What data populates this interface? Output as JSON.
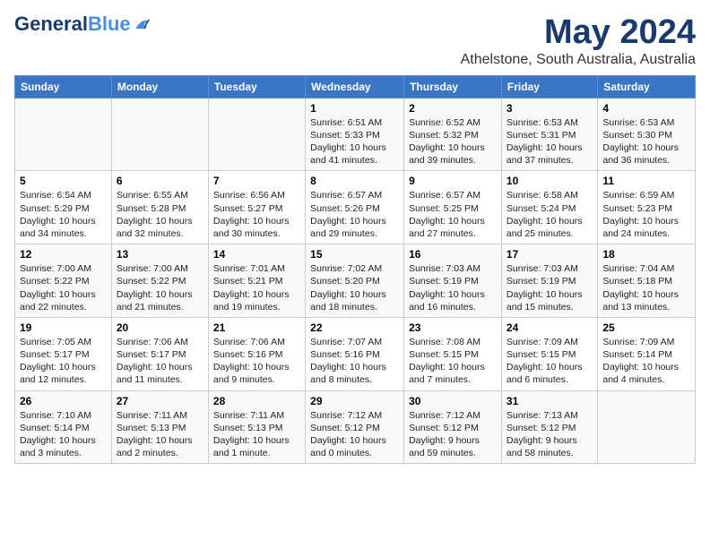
{
  "header": {
    "logo_line1": "General",
    "logo_line2": "Blue",
    "title": "May 2024",
    "subtitle": "Athelstone, South Australia, Australia"
  },
  "weekdays": [
    "Sunday",
    "Monday",
    "Tuesday",
    "Wednesday",
    "Thursday",
    "Friday",
    "Saturday"
  ],
  "weeks": [
    [
      {
        "day": "",
        "info": ""
      },
      {
        "day": "",
        "info": ""
      },
      {
        "day": "",
        "info": ""
      },
      {
        "day": "1",
        "info": "Sunrise: 6:51 AM\nSunset: 5:33 PM\nDaylight: 10 hours\nand 41 minutes."
      },
      {
        "day": "2",
        "info": "Sunrise: 6:52 AM\nSunset: 5:32 PM\nDaylight: 10 hours\nand 39 minutes."
      },
      {
        "day": "3",
        "info": "Sunrise: 6:53 AM\nSunset: 5:31 PM\nDaylight: 10 hours\nand 37 minutes."
      },
      {
        "day": "4",
        "info": "Sunrise: 6:53 AM\nSunset: 5:30 PM\nDaylight: 10 hours\nand 36 minutes."
      }
    ],
    [
      {
        "day": "5",
        "info": "Sunrise: 6:54 AM\nSunset: 5:29 PM\nDaylight: 10 hours\nand 34 minutes."
      },
      {
        "day": "6",
        "info": "Sunrise: 6:55 AM\nSunset: 5:28 PM\nDaylight: 10 hours\nand 32 minutes."
      },
      {
        "day": "7",
        "info": "Sunrise: 6:56 AM\nSunset: 5:27 PM\nDaylight: 10 hours\nand 30 minutes."
      },
      {
        "day": "8",
        "info": "Sunrise: 6:57 AM\nSunset: 5:26 PM\nDaylight: 10 hours\nand 29 minutes."
      },
      {
        "day": "9",
        "info": "Sunrise: 6:57 AM\nSunset: 5:25 PM\nDaylight: 10 hours\nand 27 minutes."
      },
      {
        "day": "10",
        "info": "Sunrise: 6:58 AM\nSunset: 5:24 PM\nDaylight: 10 hours\nand 25 minutes."
      },
      {
        "day": "11",
        "info": "Sunrise: 6:59 AM\nSunset: 5:23 PM\nDaylight: 10 hours\nand 24 minutes."
      }
    ],
    [
      {
        "day": "12",
        "info": "Sunrise: 7:00 AM\nSunset: 5:22 PM\nDaylight: 10 hours\nand 22 minutes."
      },
      {
        "day": "13",
        "info": "Sunrise: 7:00 AM\nSunset: 5:22 PM\nDaylight: 10 hours\nand 21 minutes."
      },
      {
        "day": "14",
        "info": "Sunrise: 7:01 AM\nSunset: 5:21 PM\nDaylight: 10 hours\nand 19 minutes."
      },
      {
        "day": "15",
        "info": "Sunrise: 7:02 AM\nSunset: 5:20 PM\nDaylight: 10 hours\nand 18 minutes."
      },
      {
        "day": "16",
        "info": "Sunrise: 7:03 AM\nSunset: 5:19 PM\nDaylight: 10 hours\nand 16 minutes."
      },
      {
        "day": "17",
        "info": "Sunrise: 7:03 AM\nSunset: 5:19 PM\nDaylight: 10 hours\nand 15 minutes."
      },
      {
        "day": "18",
        "info": "Sunrise: 7:04 AM\nSunset: 5:18 PM\nDaylight: 10 hours\nand 13 minutes."
      }
    ],
    [
      {
        "day": "19",
        "info": "Sunrise: 7:05 AM\nSunset: 5:17 PM\nDaylight: 10 hours\nand 12 minutes."
      },
      {
        "day": "20",
        "info": "Sunrise: 7:06 AM\nSunset: 5:17 PM\nDaylight: 10 hours\nand 11 minutes."
      },
      {
        "day": "21",
        "info": "Sunrise: 7:06 AM\nSunset: 5:16 PM\nDaylight: 10 hours\nand 9 minutes."
      },
      {
        "day": "22",
        "info": "Sunrise: 7:07 AM\nSunset: 5:16 PM\nDaylight: 10 hours\nand 8 minutes."
      },
      {
        "day": "23",
        "info": "Sunrise: 7:08 AM\nSunset: 5:15 PM\nDaylight: 10 hours\nand 7 minutes."
      },
      {
        "day": "24",
        "info": "Sunrise: 7:09 AM\nSunset: 5:15 PM\nDaylight: 10 hours\nand 6 minutes."
      },
      {
        "day": "25",
        "info": "Sunrise: 7:09 AM\nSunset: 5:14 PM\nDaylight: 10 hours\nand 4 minutes."
      }
    ],
    [
      {
        "day": "26",
        "info": "Sunrise: 7:10 AM\nSunset: 5:14 PM\nDaylight: 10 hours\nand 3 minutes."
      },
      {
        "day": "27",
        "info": "Sunrise: 7:11 AM\nSunset: 5:13 PM\nDaylight: 10 hours\nand 2 minutes."
      },
      {
        "day": "28",
        "info": "Sunrise: 7:11 AM\nSunset: 5:13 PM\nDaylight: 10 hours\nand 1 minute."
      },
      {
        "day": "29",
        "info": "Sunrise: 7:12 AM\nSunset: 5:12 PM\nDaylight: 10 hours\nand 0 minutes."
      },
      {
        "day": "30",
        "info": "Sunrise: 7:12 AM\nSunset: 5:12 PM\nDaylight: 9 hours\nand 59 minutes."
      },
      {
        "day": "31",
        "info": "Sunrise: 7:13 AM\nSunset: 5:12 PM\nDaylight: 9 hours\nand 58 minutes."
      },
      {
        "day": "",
        "info": ""
      }
    ]
  ]
}
